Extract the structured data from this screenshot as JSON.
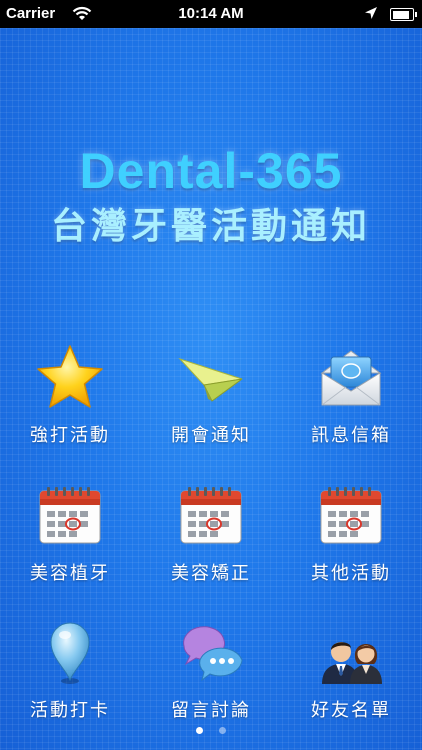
{
  "status_bar": {
    "carrier": "Carrier",
    "time": "10:14 AM"
  },
  "header": {
    "title": "Dental-365",
    "subtitle": "台灣牙醫活動通知"
  },
  "menu": [
    {
      "label": "強打活動",
      "icon": "star-icon"
    },
    {
      "label": "開會通知",
      "icon": "paper-plane-icon"
    },
    {
      "label": "訊息信箱",
      "icon": "mail-icon"
    },
    {
      "label": "美容植牙",
      "icon": "calendar-icon"
    },
    {
      "label": "美容矯正",
      "icon": "calendar-icon"
    },
    {
      "label": "其他活動",
      "icon": "calendar-icon"
    },
    {
      "label": "活動打卡",
      "icon": "map-pin-icon"
    },
    {
      "label": "留言討論",
      "icon": "chat-bubbles-icon"
    },
    {
      "label": "好友名單",
      "icon": "friends-icon"
    }
  ],
  "pager": {
    "current_page": 1,
    "page_count": 2
  },
  "colors": {
    "background": "#1f78ea",
    "title": "#3fd0ff",
    "subtitle": "#a9efff"
  }
}
